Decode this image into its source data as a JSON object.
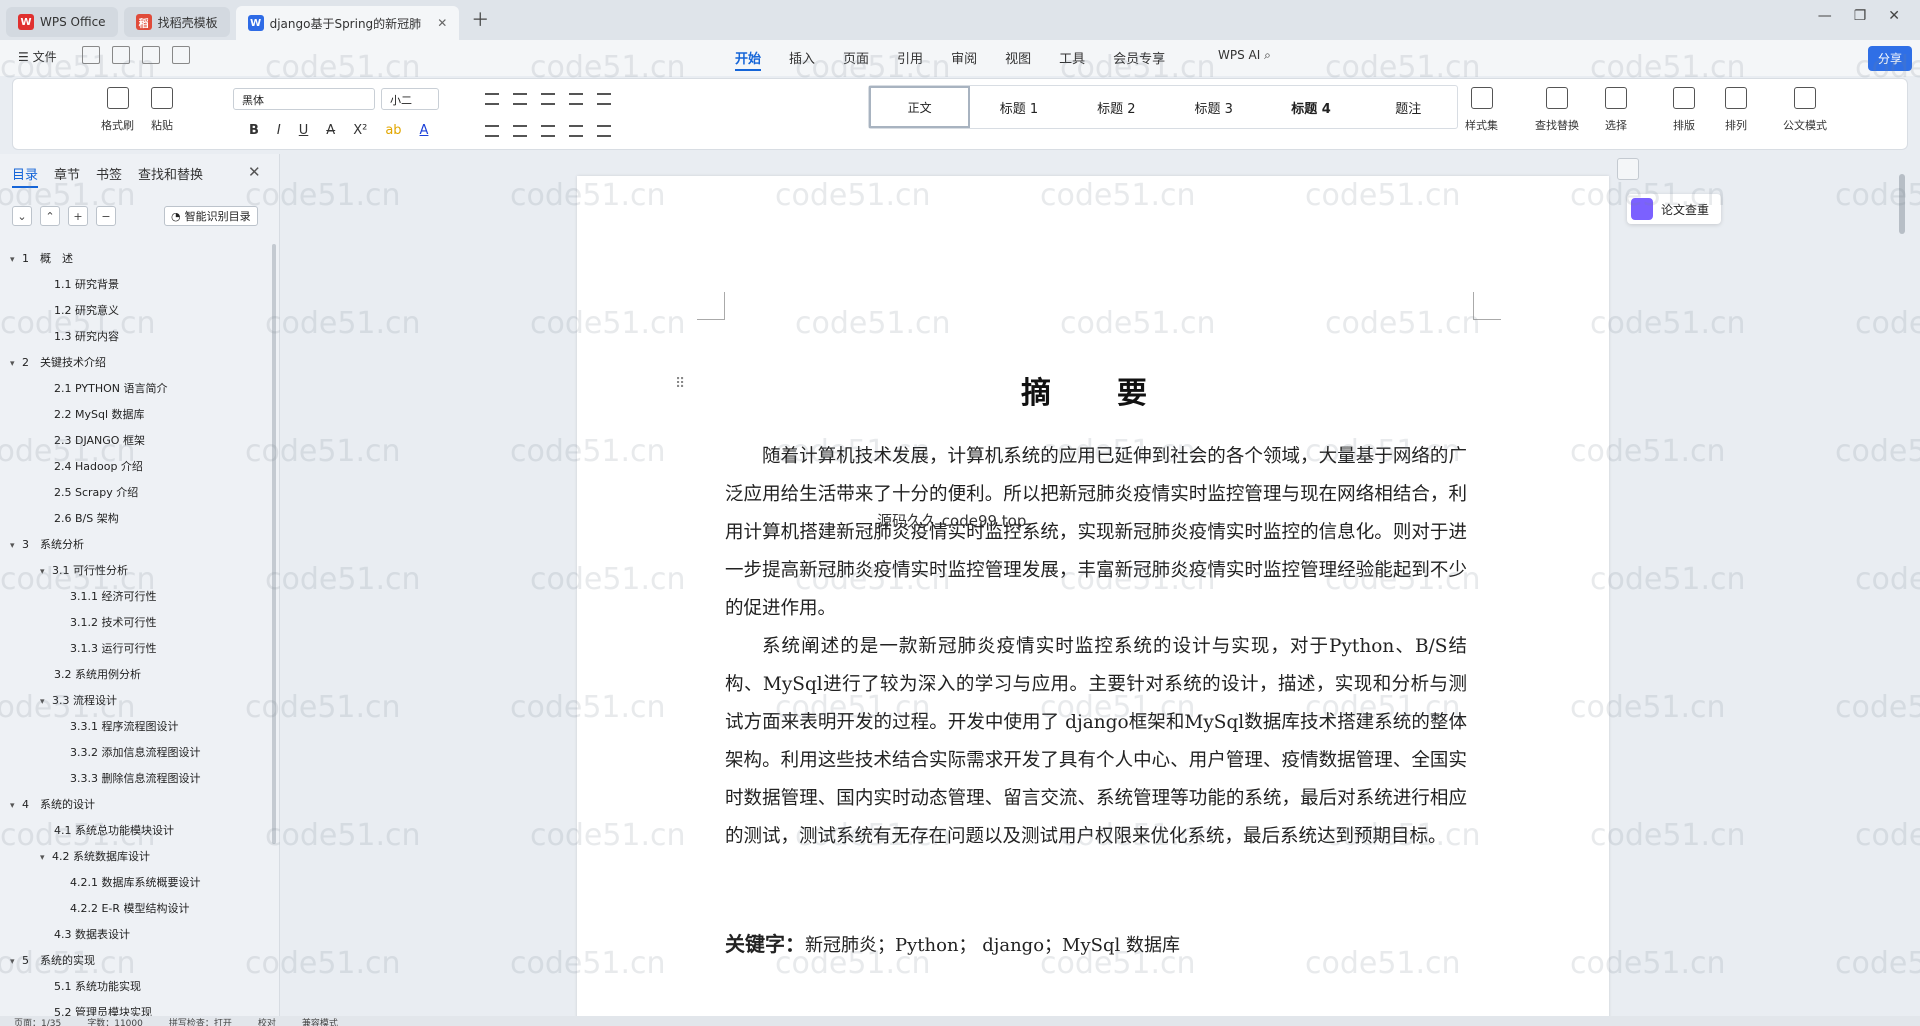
{
  "tabs": [
    {
      "label": "WPS Office",
      "logo": "W",
      "color": "#e0302f"
    },
    {
      "label": "找稻壳模板",
      "logo": "稻",
      "color": "#e04b3a"
    },
    {
      "label": "django基于Spring的新冠肺",
      "logo": "W",
      "color": "#2e6be6"
    }
  ],
  "menu": {
    "file": "文件",
    "tabs": [
      "开始",
      "插入",
      "页面",
      "引用",
      "审阅",
      "视图",
      "工具",
      "会员专享"
    ],
    "wps_ai": "WPS AI",
    "share": "分享"
  },
  "toolbar": {
    "format_painter": "格式刷",
    "paste": "粘贴",
    "font": "黑体",
    "size": "小二",
    "styles": [
      "正文",
      "标题 1",
      "标题 2",
      "标题 3",
      "标题 4",
      "题注"
    ],
    "style_set": "样式集",
    "find_replace": "查找替换",
    "select": "选择",
    "layout": "排版",
    "arrange": "排列",
    "official": "公文模式"
  },
  "nav": {
    "tabs": [
      "目录",
      "章节",
      "书签",
      "查找和替换"
    ],
    "smart": "智能识别目录",
    "items": [
      {
        "label": "1　概　述",
        "level": 1
      },
      {
        "label": "1.1 研究背景",
        "level": 2
      },
      {
        "label": "1.2 研究意义",
        "level": 2
      },
      {
        "label": "1.3 研究内容",
        "level": 2
      },
      {
        "label": "2　关键技术介绍",
        "level": 1
      },
      {
        "label": "2.1 PYTHON 语言简介",
        "level": 2
      },
      {
        "label": "2.2 MySql 数据库",
        "level": 2
      },
      {
        "label": "2.3 DJANGO 框架",
        "level": 2
      },
      {
        "label": "2.4 Hadoop 介绍",
        "level": 2
      },
      {
        "label": "2.5 Scrapy 介绍",
        "level": 2
      },
      {
        "label": "2.6 B/S 架构",
        "level": 2
      },
      {
        "label": "3　系统分析",
        "level": 1
      },
      {
        "label": "3.1 可行性分析",
        "level": 2,
        "caret": true
      },
      {
        "label": "3.1.1 经济可行性",
        "level": 3
      },
      {
        "label": "3.1.2 技术可行性",
        "level": 3
      },
      {
        "label": "3.1.3 运行可行性",
        "level": 3
      },
      {
        "label": "3.2 系统用例分析",
        "level": 2
      },
      {
        "label": "3.3 流程设计",
        "level": 2,
        "caret": true
      },
      {
        "label": "3.3.1 程序流程图设计",
        "level": 3
      },
      {
        "label": "3.3.2 添加信息流程图设计",
        "level": 3
      },
      {
        "label": "3.3.3 删除信息流程图设计",
        "level": 3
      },
      {
        "label": "4　系统的设计",
        "level": 1
      },
      {
        "label": "4.1 系统总功能模块设计",
        "level": 2
      },
      {
        "label": "4.2 系统数据库设计",
        "level": 2,
        "caret": true
      },
      {
        "label": "4.2.1 数据库系统概要设计",
        "level": 3
      },
      {
        "label": "4.2.2 E-R 模型结构设计",
        "level": 3
      },
      {
        "label": "4.3 数据表设计",
        "level": 2
      },
      {
        "label": "5　系统的实现",
        "level": 1
      },
      {
        "label": "5.1 系统功能实现",
        "level": 2
      },
      {
        "label": "5.2 管理员模块实现",
        "level": 2
      }
    ]
  },
  "document": {
    "title": "摘　要",
    "paragraphs": [
      "随着计算机技术发展，计算机系统的应用已延伸到社会的各个领域，大量基于网络的广泛应用给生活带来了十分的便利。所以把新冠肺炎疫情实时监控管理与现在网络相结合，利用计算机搭建新冠肺炎疫情实时监控系统，实现新冠肺炎疫情实时监控的信息化。则对于进一步提高新冠肺炎疫情实时监控管理发展，丰富新冠肺炎疫情实时监控管理经验能起到不少的促进作用。",
      "系统阐述的是一款新冠肺炎疫情实时监控系统的设计与实现，对于Python、B/S结构、MySql进行了较为深入的学习与应用。主要针对系统的设计，描述，实现和分析与测试方面来表明开发的过程。开发中使用了 django框架和MySql数据库技术搭建系统的整体架构。利用这些技术结合实际需求开发了具有个人中心、用户管理、疫情数据管理、全国实时数据管理、国内实时动态管理、留言交流、系统管理等功能的系统，最后对系统进行相应的测试，测试系统有无存在问题以及测试用户权限来优化系统，最后系统达到预期目标。"
    ],
    "keywords_label": "关键字：",
    "keywords": "新冠肺炎；Python； django；MySql 数据库",
    "overlay": "源码久久 code99 top"
  },
  "right_panel": {
    "check": "论文查重"
  },
  "watermark": "code51.cn",
  "status": [
    "页面：1/35",
    "字数：11000",
    "拼写检查：打开",
    "校对",
    "兼容模式"
  ]
}
